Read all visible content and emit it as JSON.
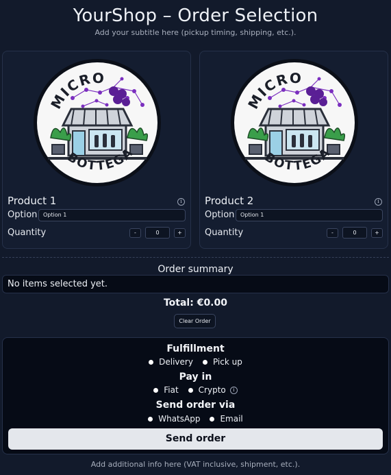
{
  "header": {
    "title": "YourShop – Order Selection",
    "subtitle": "Add your subtitle here (pickup timing, shipping, etc.)."
  },
  "logo": {
    "top_text": "MICRO",
    "bottom_text": "BOTTEGA"
  },
  "products": [
    {
      "name": "Product 1",
      "option_label": "Option",
      "option_value": "Option 1",
      "quantity_label": "Quantity",
      "quantity": "0",
      "minus_label": "-",
      "plus_label": "+",
      "info_glyph": "i"
    },
    {
      "name": "Product 2",
      "option_label": "Option",
      "option_value": "Option 1",
      "quantity_label": "Quantity",
      "quantity": "0",
      "minus_label": "-",
      "plus_label": "+",
      "info_glyph": "i"
    }
  ],
  "summary": {
    "title": "Order summary",
    "empty_text": "No items selected yet.",
    "total": "Total: €0.00",
    "clear_label": "Clear Order"
  },
  "fulfillment": {
    "title": "Fulfillment",
    "options": [
      "Delivery",
      "Pick up"
    ]
  },
  "pay": {
    "title": "Pay in",
    "options": [
      "Fiat",
      "Crypto"
    ],
    "info_glyph": "i"
  },
  "send_via": {
    "title": "Send order via",
    "options": [
      "WhatsApp",
      "Email"
    ]
  },
  "send_button": "Send order",
  "footer": "Add additional info here (VAT inclusive, shipment, etc.).",
  "colors": {
    "background": "#121a2b",
    "panel": "#060b16",
    "accent_purple": "#7b2fbf",
    "button_light": "#e4e7ec"
  }
}
